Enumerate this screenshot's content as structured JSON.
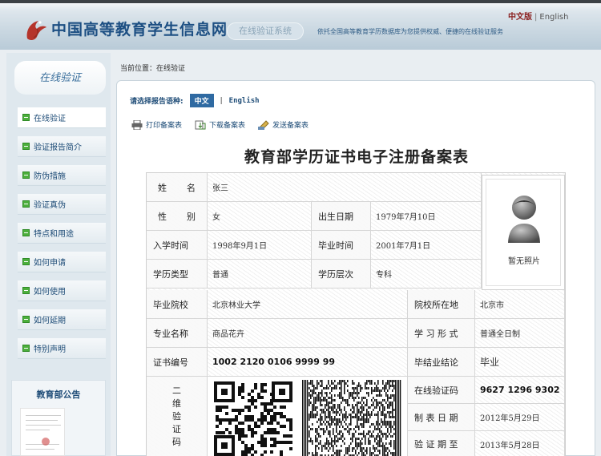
{
  "header": {
    "site_title": "中国高等教育学生信息网",
    "sub_title": "在线验证系统",
    "slogan": "依托全国高等教育学历数据库为您提供权威、便捷的在线验证服务",
    "lang_current": "中文版",
    "lang_separator": "|",
    "lang_other": "English",
    "logo_icon": "red-bird-logo-icon"
  },
  "sidebar": {
    "title": "在线验证",
    "items": [
      {
        "label": "在线验证",
        "active": true
      },
      {
        "label": "验证报告简介",
        "active": false
      },
      {
        "label": "防伪措施",
        "active": false
      },
      {
        "label": "验证真伪",
        "active": false
      },
      {
        "label": "特点和用途",
        "active": false
      },
      {
        "label": "如何申请",
        "active": false
      },
      {
        "label": "如何使用",
        "active": false
      },
      {
        "label": "如何延期",
        "active": false
      },
      {
        "label": "特别声明",
        "active": false
      }
    ],
    "notice_title": "教育部公告"
  },
  "breadcrumb": "当前位置：在线验证",
  "language_select": {
    "label": "请选择报告语种:",
    "chinese": "中文",
    "separator": "|",
    "english": "English"
  },
  "actions": [
    {
      "label": "打印备案表",
      "icon": "printer-icon"
    },
    {
      "label": "下载备案表",
      "icon": "download-icon"
    },
    {
      "label": "发送备案表",
      "icon": "send-icon"
    }
  ],
  "document_title": "教育部学历证书电子注册备案表",
  "certificate": {
    "name_label_1": "姓",
    "name_label_2": "名",
    "name": "张三",
    "gender_label_1": "性",
    "gender_label_2": "别",
    "gender": "女",
    "birth_label": "出生日期",
    "birth": "1979年7月10日",
    "enroll_label": "入学时间",
    "enroll": "1998年9月1日",
    "graduate_time_label": "毕业时间",
    "graduate_time": "2001年7月1日",
    "edu_type_label": "学历类型",
    "edu_type": "普通",
    "edu_level_label": "学历层次",
    "edu_level": "专科",
    "school_label": "毕业院校",
    "school": "北京林业大学",
    "location_label": "院校所在地",
    "location": "北京市",
    "major_label": "专业名称",
    "major": "商品花卉",
    "study_form_label": "学 习 形 式",
    "study_form": "普通全日制",
    "cert_no_label": "证书编号",
    "cert_no": "1002 2120 0106 9999 99",
    "conclusion_label": "毕结业结论",
    "conclusion": "毕业",
    "verify_code_label": "在线验证码",
    "verify_code": "9627 1296 9302",
    "issue_date_label": "制 表 日 期",
    "issue_date": "2012年5月29日",
    "expire_label": "验 证 期 至",
    "expire": "2013年5月28日",
    "qr_label": [
      "二",
      "维",
      "验",
      "证",
      "码"
    ],
    "photo_caption": "暂无照片",
    "photo_icon": "avatar-placeholder-icon",
    "qr_icon": "qr-code-icon",
    "pdf417_icon": "pdf417-barcode-icon"
  }
}
